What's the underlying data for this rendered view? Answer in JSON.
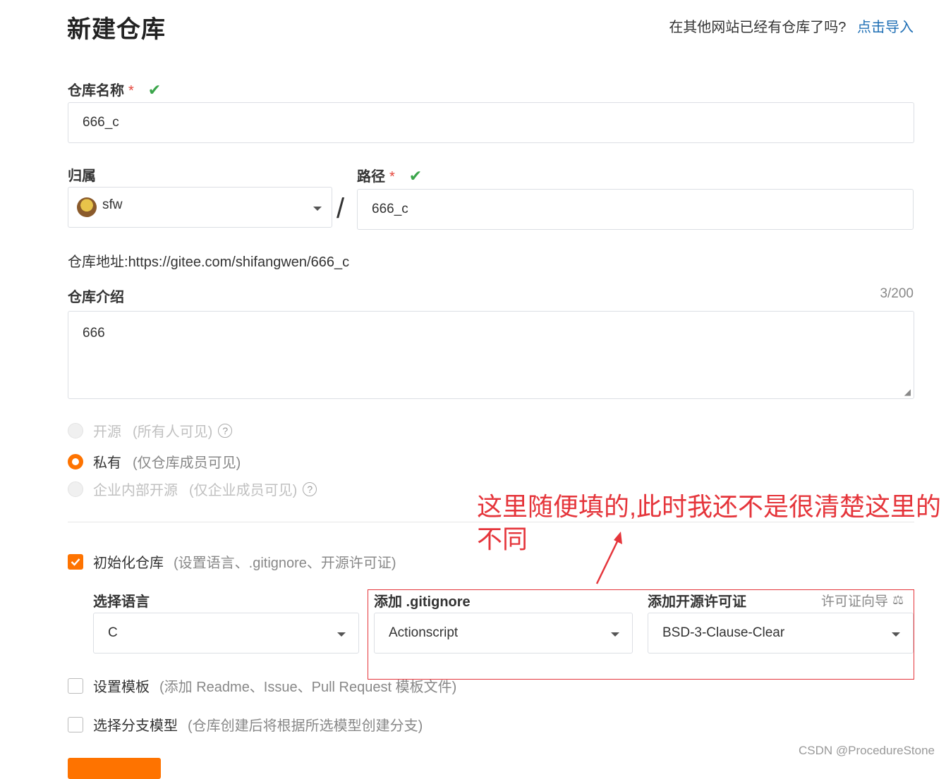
{
  "page": {
    "title": "新建仓库",
    "import_prompt": "在其他网站已经有仓库了吗?",
    "import_link": "点击导入"
  },
  "repo_name": {
    "label": "仓库名称",
    "required_mark": "*",
    "value": "666_c"
  },
  "owner": {
    "label": "归属",
    "value": "sfw"
  },
  "separator": "/",
  "path": {
    "label": "路径",
    "required_mark": "*",
    "value": "666_c"
  },
  "repo_url": {
    "prefix": "仓库地址:",
    "url": "https://gitee.com/shifangwen/666_c"
  },
  "description": {
    "label": "仓库介绍",
    "counter": "3/200",
    "value": "666"
  },
  "visibility": {
    "options": [
      {
        "label": "开源",
        "hint": "(所有人可见)",
        "state": "disabled"
      },
      {
        "label": "私有",
        "hint": "(仅仓库成员可见)",
        "state": "selected"
      },
      {
        "label": "企业内部开源",
        "hint": "(仅企业成员可见)",
        "state": "disabled"
      }
    ]
  },
  "init_repo": {
    "label": "初始化仓库",
    "hint": "(设置语言、.gitignore、开源许可证)",
    "checked": true
  },
  "language": {
    "label": "选择语言",
    "value": "C"
  },
  "gitignore": {
    "label": "添加 .gitignore",
    "value": "Actionscript"
  },
  "license": {
    "label": "添加开源许可证",
    "guide": "许可证向导",
    "value": "BSD-3-Clause-Clear"
  },
  "template": {
    "label": "设置模板",
    "hint": "(添加 Readme、Issue、Pull Request 模板文件)",
    "checked": false
  },
  "branch_model": {
    "label": "选择分支模型",
    "hint": "(仓库创建后将根据所选模型创建分支)",
    "checked": false
  },
  "annotation": {
    "text": "这里随便填的,此时我还不是很清楚这里的不同"
  },
  "watermark": "CSDN @ProcedureStone",
  "colors": {
    "accent": "#fe7300",
    "link": "#1f6fb5",
    "success": "#3aa54a",
    "annotation": "#e5353b"
  }
}
